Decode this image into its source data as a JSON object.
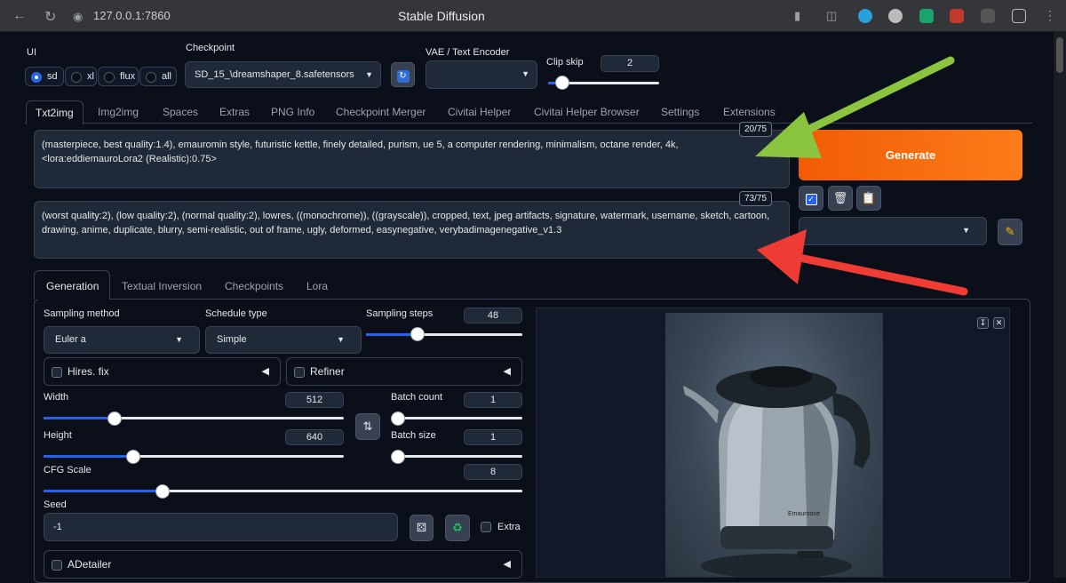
{
  "browser": {
    "url": "127.0.0.1:7860",
    "title": "Stable Diffusion"
  },
  "ui_selector": {
    "label": "UI",
    "options": [
      "sd",
      "xl",
      "flux",
      "all"
    ],
    "selected": "sd"
  },
  "checkpoint": {
    "label": "Checkpoint",
    "value": "SD_15_\\dreamshaper_8.safetensors"
  },
  "vae": {
    "label": "VAE / Text Encoder",
    "value": ""
  },
  "clip_skip": {
    "label": "Clip skip",
    "value": "2",
    "fraction": 0.1
  },
  "tabs": [
    "Txt2img",
    "Img2img",
    "Spaces",
    "Extras",
    "PNG Info",
    "Checkpoint Merger",
    "Civitai Helper",
    "Civitai Helper Browser",
    "Settings",
    "Extensions"
  ],
  "prompt": {
    "text": "(masterpiece, best quality:1.4), emauromin style, futuristic kettle, finely detailed, purism, ue 5, a computer rendering, minimalism, octane render, 4k, <lora:eddiemauroLora2 (Realistic):0.75>",
    "counter": "20/75"
  },
  "negative_prompt": {
    "text": "(worst quality:2), (low quality:2), (normal quality:2), lowres, ((monochrome)), ((grayscale)), cropped, text, jpeg artifacts, signature, watermark, username, sketch, cartoon, drawing, anime, duplicate, blurry, semi-realistic, out of frame, ugly, deformed, easynegative, verybadimagenegative_v1.3",
    "counter": "73/75"
  },
  "generate_label": "Generate",
  "subtabs": [
    "Generation",
    "Textual Inversion",
    "Checkpoints",
    "Lora"
  ],
  "generation": {
    "sampling_method": {
      "label": "Sampling method",
      "value": "Euler a"
    },
    "schedule_type": {
      "label": "Schedule type",
      "value": "Simple"
    },
    "sampling_steps": {
      "label": "Sampling steps",
      "value": "48",
      "fraction": 0.32
    },
    "hires_fix": "Hires. fix",
    "refiner": "Refiner",
    "width": {
      "label": "Width",
      "value": "512",
      "fraction": 0.24
    },
    "height": {
      "label": "Height",
      "value": "640",
      "fraction": 0.3
    },
    "batch_count": {
      "label": "Batch count",
      "value": "1",
      "fraction": 0.0
    },
    "batch_size": {
      "label": "Batch size",
      "value": "1",
      "fraction": 0.0
    },
    "cfg_scale": {
      "label": "CFG Scale",
      "value": "8",
      "fraction": 0.25
    },
    "seed": {
      "label": "Seed",
      "value": "-1"
    },
    "extra": "Extra",
    "adetailer": "ADetailer"
  },
  "output_image": {
    "brand_text": "Emauroone"
  },
  "annotations": {
    "green_arrow_color": "#8bc53f",
    "red_arrow_color": "#ee3b33",
    "accent": "#2563eb",
    "generate_color": "#f97316"
  }
}
